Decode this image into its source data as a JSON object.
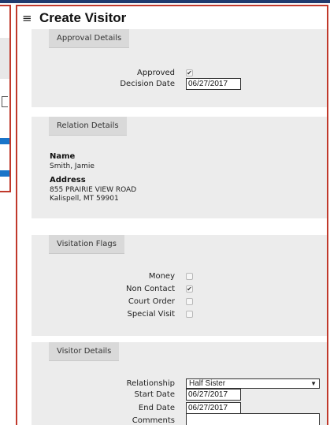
{
  "page": {
    "title": "Create Visitor",
    "menu_icon": "hamburger-menu-icon"
  },
  "approval": {
    "tab": "Approval Details",
    "approved_label": "Approved",
    "approved_checked": true,
    "decision_label": "Decision Date",
    "decision_value": "06/27/2017"
  },
  "relation": {
    "tab": "Relation Details",
    "name_heading": "Name",
    "name_value": "Smith, Jamie",
    "address_heading": "Address",
    "address_line1": "855 PRAIRIE VIEW ROAD",
    "address_line2": "Kalispell, MT 59901"
  },
  "flags": {
    "tab": "Visitation Flags",
    "items": [
      {
        "label": "Money",
        "checked": false
      },
      {
        "label": "Non Contact",
        "checked": true
      },
      {
        "label": "Court Order",
        "checked": false
      },
      {
        "label": "Special Visit",
        "checked": false
      }
    ]
  },
  "visitor": {
    "tab": "Visitor Details",
    "relationship_label": "Relationship",
    "relationship_value": "Half Sister",
    "start_label": "Start Date",
    "start_value": "06/27/2017",
    "end_label": "End Date",
    "end_value": "06/27/2017",
    "comments_label": "Comments",
    "comments_value": ""
  },
  "colors": {
    "border": "#c0392b",
    "accent": "#1a75c9",
    "section_bg": "#ececec",
    "tab_bg": "#d9d9d9"
  }
}
